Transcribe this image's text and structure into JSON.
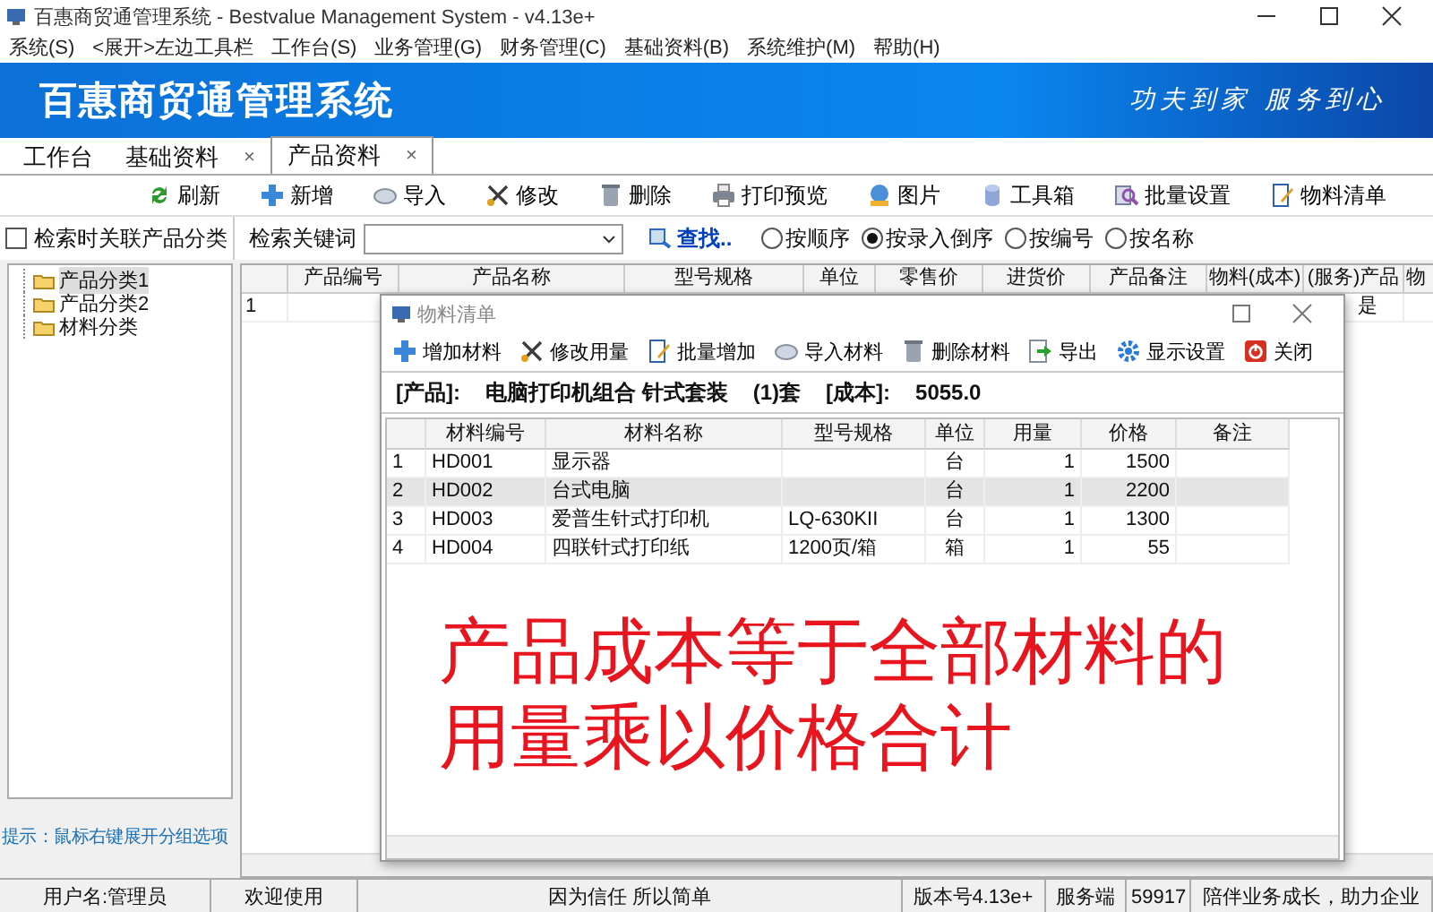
{
  "window": {
    "title": "百惠商贸通管理系统 - Bestvalue Management System - v4.13e+"
  },
  "menu": [
    "系统(S)",
    "<展开>左边工具栏",
    "工作台(S)",
    "业务管理(G)",
    "财务管理(C)",
    "基础资料(B)",
    "系统维护(M)",
    "帮助(H)"
  ],
  "banner": {
    "title": "百惠商贸通管理系统",
    "slogan": "功夫到家 服务到心"
  },
  "tabs": [
    {
      "label": "工作台",
      "selected": false
    },
    {
      "label": "基础资料",
      "selected": false,
      "close_mark": "×"
    },
    {
      "label": "产品资料",
      "selected": true,
      "close_mark": "×"
    }
  ],
  "toolbar": [
    {
      "label": "刷新",
      "kind": "refresh"
    },
    {
      "label": "新增",
      "kind": "plus"
    },
    {
      "label": "导入",
      "kind": "disc"
    },
    {
      "label": "修改",
      "kind": "edit"
    },
    {
      "label": "删除",
      "kind": "trash"
    },
    {
      "label": "打印预览",
      "kind": "printer"
    },
    {
      "label": "图片",
      "kind": "picture"
    },
    {
      "label": "工具箱",
      "kind": "cylinder"
    },
    {
      "label": "批量设置",
      "kind": "magnifier"
    },
    {
      "label": "物料清单",
      "kind": "notepad"
    }
  ],
  "search": {
    "related_category": {
      "label": "检索时关联产品分类",
      "checked": false
    },
    "keyword_label": "检索关键词",
    "find_link": "查找..",
    "sort_options": [
      {
        "label": "按顺序",
        "selected": false
      },
      {
        "label": "按录入倒序",
        "selected": true
      },
      {
        "label": "按编号",
        "selected": false
      },
      {
        "label": "按名称",
        "selected": false
      }
    ]
  },
  "tree": [
    {
      "label": "产品分类1",
      "selected": true
    },
    {
      "label": "产品分类2",
      "selected": false
    },
    {
      "label": "材料分类",
      "selected": false
    }
  ],
  "hint": "提示：鼠标右键展开分组选项",
  "main_table": {
    "columns": [
      "产品编号",
      "产品名称",
      "型号规格",
      "单位",
      "零售价",
      "进货价",
      "产品备注",
      "物料(成本)",
      "(服务)产品",
      "物"
    ],
    "rows": [
      {
        "number": "1",
        "service_product": "是"
      }
    ]
  },
  "dialog": {
    "title": "物料清单",
    "toolbar": [
      {
        "label": "增加材料",
        "kind": "plus"
      },
      {
        "label": "修改用量",
        "kind": "edit"
      },
      {
        "label": "批量增加",
        "kind": "notepad"
      },
      {
        "label": "导入材料",
        "kind": "disc"
      },
      {
        "label": "删除材料",
        "kind": "trash"
      },
      {
        "label": "导出",
        "kind": "export"
      },
      {
        "label": "显示设置",
        "kind": "gear"
      },
      {
        "label": "关闭",
        "kind": "power"
      }
    ],
    "info": {
      "product_label": "[产品]:",
      "product": "电脑打印机组合  针式套装",
      "quantity": "(1)套",
      "cost_label": "[成本]:",
      "cost": "5055.0"
    },
    "table": {
      "columns": [
        "材料编号",
        "材料名称",
        "型号规格",
        "单位",
        "用量",
        "价格",
        "备注"
      ],
      "rows": [
        {
          "number": "1",
          "code": "HD001",
          "name": "显示器",
          "unit": "台",
          "quantity": "1",
          "price": "1500",
          "selected": false
        },
        {
          "number": "2",
          "code": "HD002",
          "name": "台式电脑",
          "unit": "台",
          "quantity": "1",
          "price": "2200",
          "selected": true
        },
        {
          "number": "3",
          "code": "HD003",
          "name": "爱普生针式打印机",
          "spec": "LQ-630KII",
          "unit": "台",
          "quantity": "1",
          "price": "1300",
          "selected": false
        },
        {
          "number": "4",
          "code": "HD004",
          "name": "四联针式打印纸",
          "spec": "1200页/箱",
          "unit": "箱",
          "quantity": "1",
          "price": "55",
          "selected": false
        }
      ]
    }
  },
  "annotation": [
    "产品成本等于全部材料的",
    "用量乘以价格合计"
  ],
  "status_bar": [
    "用户名:管理员",
    "欢迎使用",
    "因为信任 所以简单",
    "版本号4.13e+",
    "服务端",
    "59917",
    "陪伴业务成长，助力企业"
  ]
}
